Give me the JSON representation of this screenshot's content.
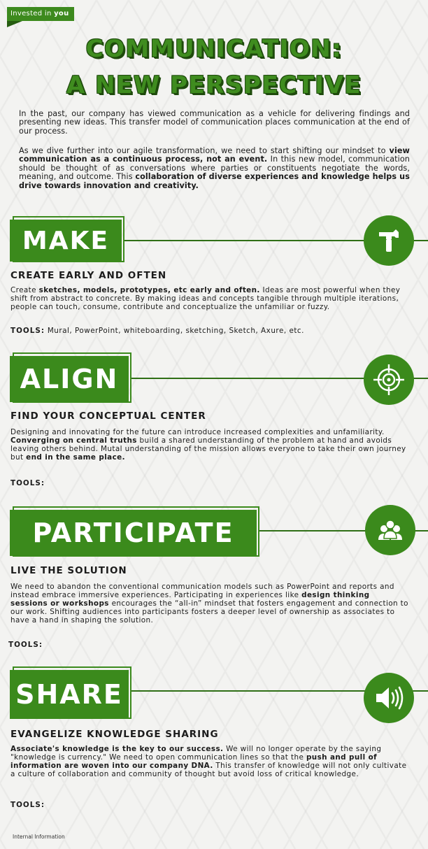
{
  "header": {
    "tag_prefix": "Invested in",
    "tag_bold": "you"
  },
  "title": {
    "line1": "COMMUNICATION:",
    "line2": "A NEW PERSPECTIVE"
  },
  "intro": {
    "p1": "In the past, our company has viewed communication as a vehicle for delivering findings and presenting new ideas. This transfer model of communication places communication at the end of our process.",
    "p2_a": "As we dive further into our agile transformation, we need to start shifting our mindset to ",
    "p2_b": "view communication as a continuous process, not an event.",
    "p2_c": " In this new model, communication should be thought of as conversations where parties or constituents negotiate the words, meaning, and outcome. This ",
    "p2_d": "collaboration of diverse experiences and knowledge helps us drive towards innovation and creativity."
  },
  "sections": [
    {
      "banner": "MAKE",
      "icon": "hammer-icon",
      "subhead": "CREATE EARLY AND OFTEN",
      "body_a": "Create ",
      "body_b": "sketches, models, prototypes, etc early and often.",
      "body_c": " Ideas are most powerful when they shift from abstract to concrete. By making ideas and concepts tangible through multiple iterations, people can touch, consume, contribute and conceptualize the unfamiliar or fuzzy.",
      "tools_label": "TOOLS:",
      "tools_value": "Mural, PowerPoint, whiteboarding, sketching, Sketch, Axure, etc."
    },
    {
      "banner": "ALIGN",
      "icon": "target-icon",
      "subhead": "FIND YOUR CONCEPTUAL CENTER",
      "body_a": "Designing and innovating for the future can introduce increased complexities and unfamiliarity. ",
      "body_b": "Converging on central truths",
      "body_c": " build a shared understanding of the problem at hand and avoids leaving others behind. Mutal understanding of the mission allows everyone to take their own journey but ",
      "body_d": "end in the same place.",
      "tools_label": "TOOLS:"
    },
    {
      "banner": "PARTICIPATE",
      "icon": "people-icon",
      "subhead": "LIVE THE SOLUTION",
      "body_a": "We need to abandon the conventional communication models such as PowerPoint and reports and instead embrace immersive experiences. Participating in experiences like ",
      "body_b": "design thinking sessions or workshops",
      "body_c": " encourages the “all-in” mindset that fosters engagement and connection to our work. Shifting audiences into participants fosters a deeper level of ownership as associates to have a hand in shaping the solution.",
      "tools_label": "TOOLS:"
    },
    {
      "banner": "SHARE",
      "icon": "speaker-icon",
      "subhead": "EVANGELIZE KNOWLEDGE SHARING",
      "body_a": "Associate's knowledge is the key to our success.",
      "body_b": " We will no longer operate by the saying \"knowledge is currency.\" We need to open communication lines so that the ",
      "body_c": "push and pull of information are woven into our company DNA.",
      "body_d": " This transfer of knowledge will not only cultivate a culture of collaboration and community of thought but avoid loss of critical knowledge.",
      "tools_label": "TOOLS:"
    }
  ],
  "footer": {
    "text": "Internal Information"
  },
  "colors": {
    "accent": "#3b8a1c",
    "accent_dark": "#2f6f16",
    "background": "#f3f3f1"
  }
}
